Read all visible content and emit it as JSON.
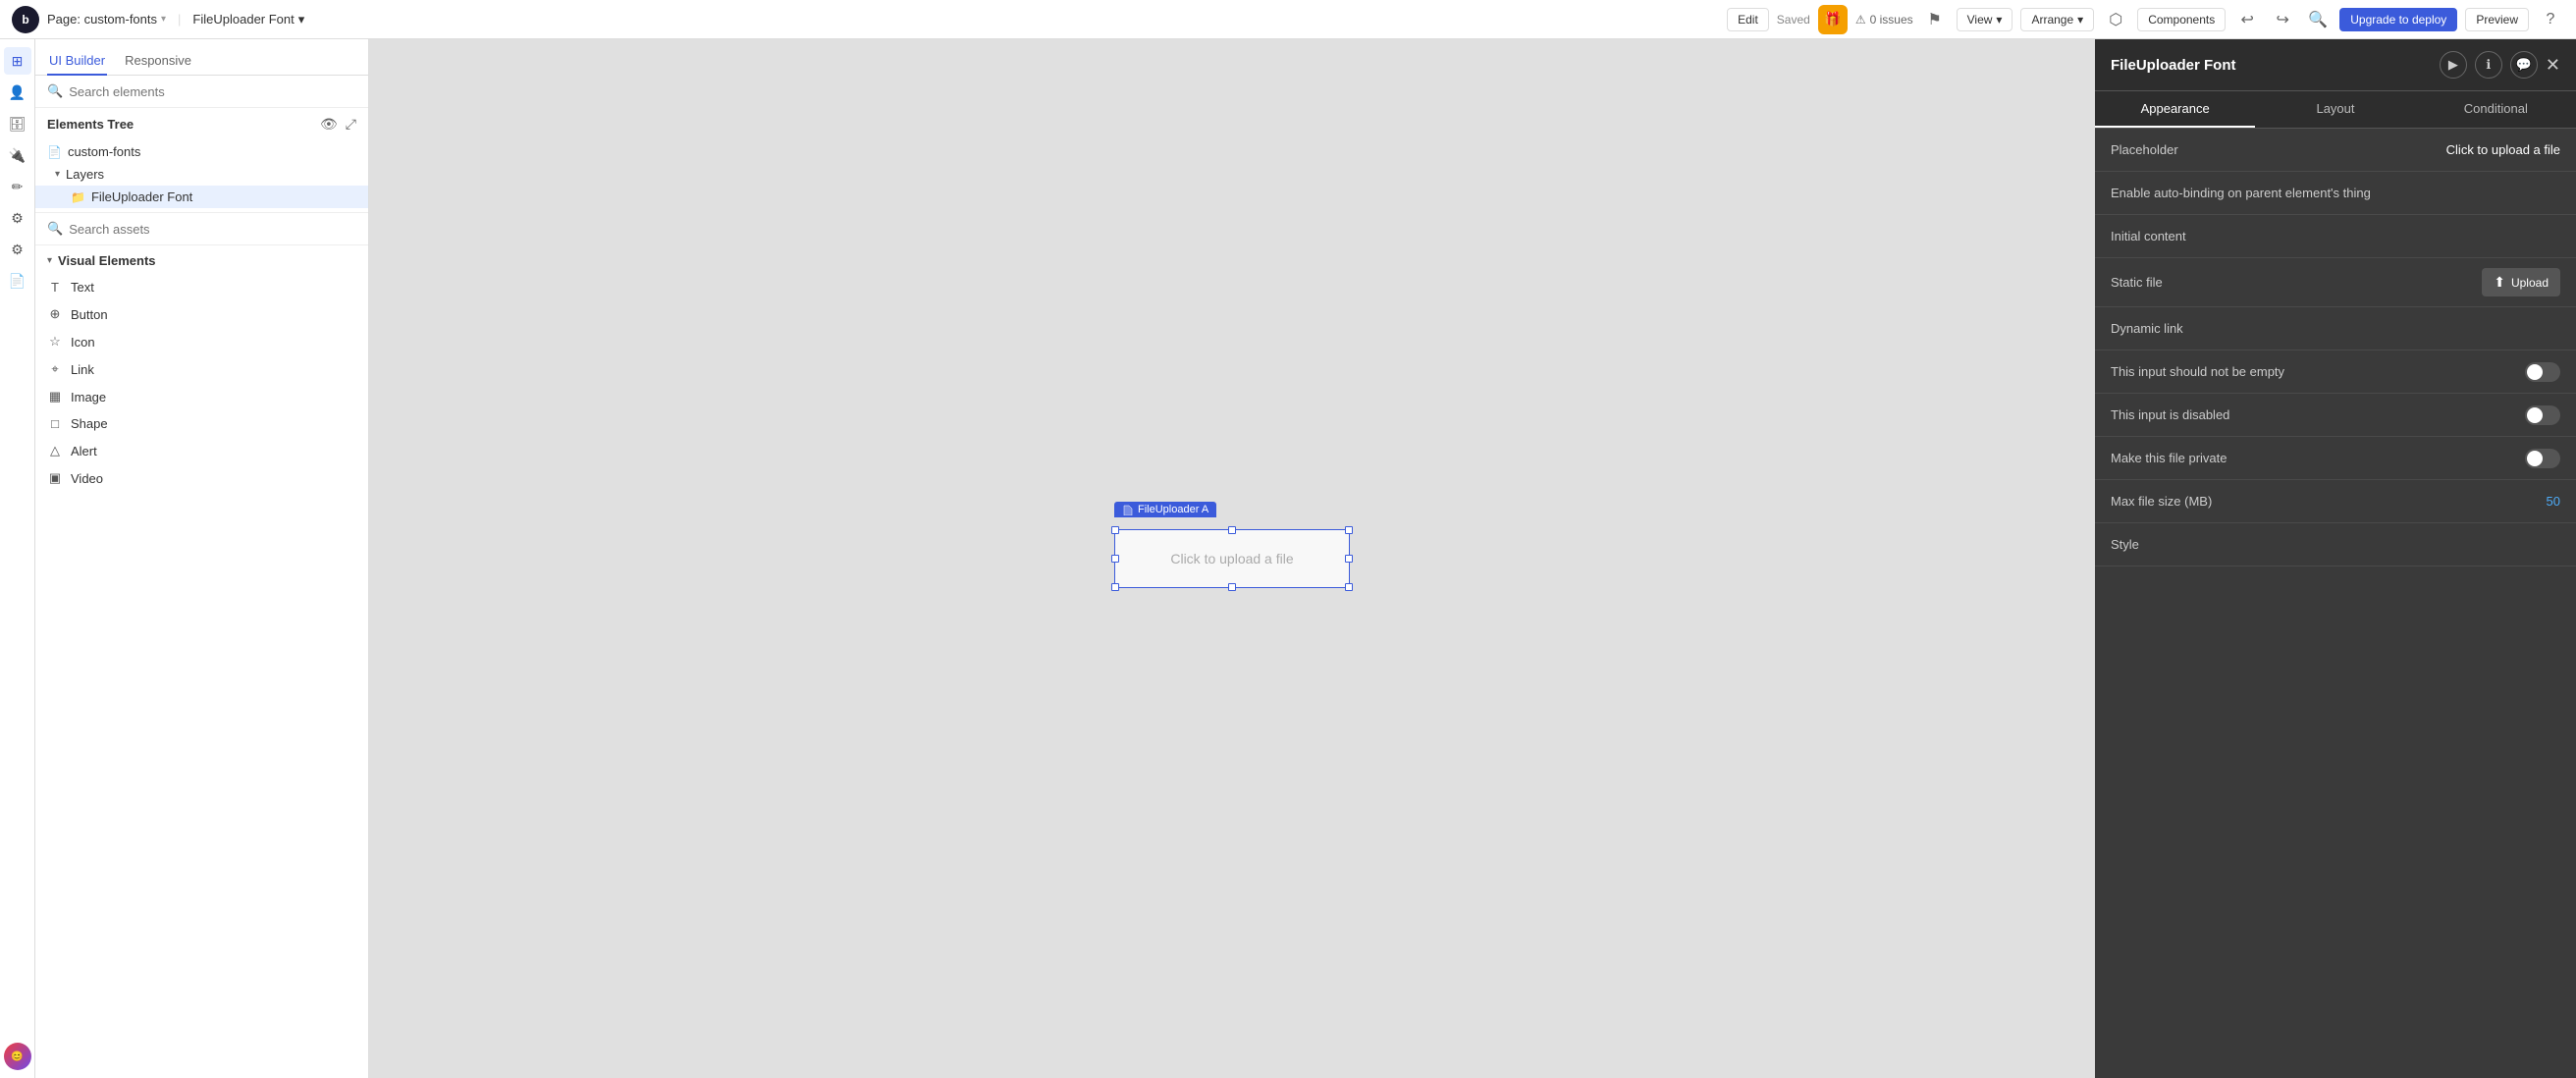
{
  "topbar": {
    "logo": "b",
    "page_name": "Page: custom-fonts",
    "component_name": "FileUploader Font",
    "edit_label": "Edit",
    "saved_label": "Saved",
    "issues_count": "0 issues",
    "view_label": "View",
    "arrange_label": "Arrange",
    "components_label": "Components",
    "upgrade_label": "Upgrade to deploy",
    "preview_label": "Preview"
  },
  "left_panel": {
    "tab_ui_builder": "UI Builder",
    "tab_responsive": "Responsive",
    "search_placeholder": "Search elements",
    "elements_tree_title": "Elements Tree",
    "page_item": "custom-fonts",
    "layers_label": "Layers",
    "layer_item": "FileUploader Font",
    "assets_placeholder": "Search assets",
    "visual_elements_title": "Visual Elements",
    "elements": [
      {
        "icon": "T",
        "label": "Text"
      },
      {
        "icon": "⊕",
        "label": "Button"
      },
      {
        "icon": "☆",
        "label": "Icon"
      },
      {
        "icon": "⌖",
        "label": "Link"
      },
      {
        "icon": "▦",
        "label": "Image"
      },
      {
        "icon": "□",
        "label": "Shape"
      },
      {
        "icon": "△",
        "label": "Alert"
      },
      {
        "icon": "▣",
        "label": "Video"
      }
    ]
  },
  "canvas": {
    "file_uploader_label": "FileUploader A",
    "file_uploader_placeholder": "Click to upload a file"
  },
  "right_panel": {
    "title": "FileUploader Font",
    "tab_appearance": "Appearance",
    "tab_layout": "Layout",
    "tab_conditional": "Conditional",
    "placeholder_label": "Placeholder",
    "placeholder_value": "Click to upload a file",
    "auto_binding_label": "Enable auto-binding on parent element's thing",
    "initial_content_label": "Initial content",
    "static_file_label": "Static file",
    "upload_btn_label": "Upload",
    "dynamic_link_label": "Dynamic link",
    "not_empty_label": "This input should not be empty",
    "disabled_label": "This input is disabled",
    "private_label": "Make this file private",
    "max_file_size_label": "Max file size (MB)",
    "max_file_size_value": "50",
    "style_label": "Style",
    "upload_icon": "⬆",
    "click_to_upload_file": "Click to upload file"
  }
}
